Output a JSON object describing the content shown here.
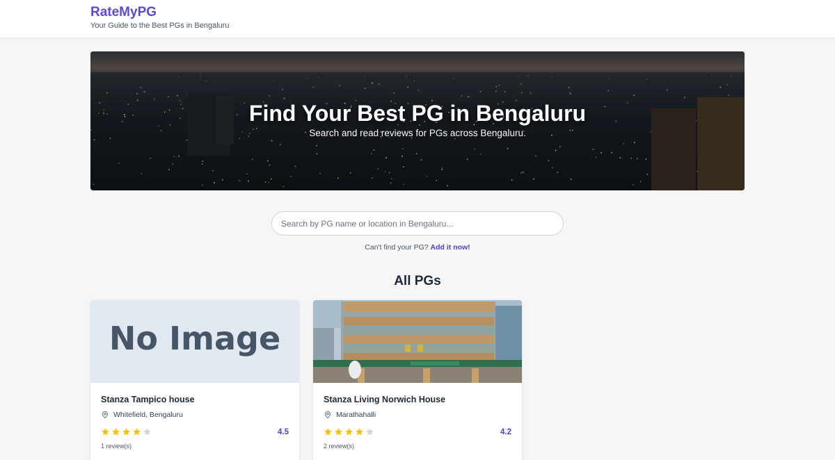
{
  "header": {
    "brand": "RateMyPG",
    "tagline": "Your Guide to the Best PGs in Bengaluru"
  },
  "hero": {
    "title": "Find Your Best PG in Bengaluru",
    "subtitle": "Search and read reviews for PGs across Bengaluru."
  },
  "search": {
    "placeholder": "Search by PG name or location in Bengaluru...",
    "value": ""
  },
  "add_prompt": {
    "text": "Can't find your PG?",
    "link": "Add it now!"
  },
  "section_title": "All PGs",
  "colors": {
    "accent": "#5b4bd4",
    "star_filled": "#f2c200",
    "star_empty": "#d1d5db"
  },
  "icons": {
    "location": "map-pin-icon",
    "rating": "star-icon"
  },
  "pgs": [
    {
      "name": "Stanza Tampico house",
      "location": "Whitefield, Bengaluru",
      "rating": "4.5",
      "stars_filled": 4,
      "stars_total": 5,
      "reviews": "1 review(s)",
      "image_text": "No Image"
    },
    {
      "name": "Stanza Living Norwich House",
      "location": "Marathahalli",
      "rating": "4.2",
      "stars_filled": 4,
      "stars_total": 5,
      "reviews": "2 review(s)",
      "image_text": ""
    }
  ]
}
